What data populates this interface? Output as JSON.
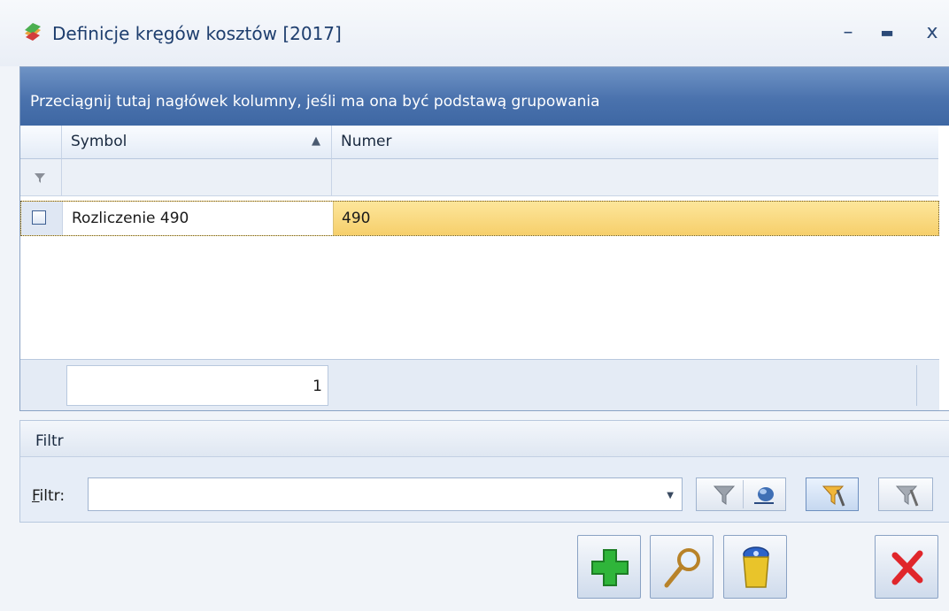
{
  "window": {
    "title": "Definicje kręgów kosztów [2017]",
    "icons": {
      "app": "app-icon",
      "minimize": "minimize-icon",
      "maximize": "maximize-icon",
      "close": "close-icon"
    },
    "minimize_glyph": "–",
    "maximize_glyph": "▬",
    "close_glyph": "x"
  },
  "grid": {
    "group_panel_text": "Przeciągnij tutaj nagłówek kolumny, jeśli ma ona być podstawą grupowania",
    "columns": [
      {
        "label": "Symbol",
        "sort": "ascending"
      },
      {
        "label": "Numer"
      }
    ],
    "sort_glyph": "▲",
    "rows": [
      {
        "checked": false,
        "symbol": "Rozliczenie 490",
        "numer": "490",
        "selected": true
      }
    ],
    "footer_count": "1"
  },
  "filter": {
    "section_title": "Filtr",
    "label_prefix": "F",
    "label_rest": "iltr:",
    "value": "",
    "dropdown_glyph": "▼"
  },
  "toolbar_icons": [
    "funnel-icon",
    "funnel-run-icon",
    "filter-settings-icon",
    "clear-filter-icon"
  ],
  "actions": [
    {
      "name": "add-button",
      "icon": "plus-icon"
    },
    {
      "name": "edit-button",
      "icon": "magnifier-icon"
    },
    {
      "name": "delete-button",
      "icon": "trash-icon"
    },
    {
      "name": "close-button",
      "icon": "x-mark-icon"
    }
  ],
  "colors": {
    "group_panel": "#4a72ad",
    "selected_row": "#f6cf6b",
    "add": "#2fb53a",
    "cancel": "#e0262b"
  }
}
